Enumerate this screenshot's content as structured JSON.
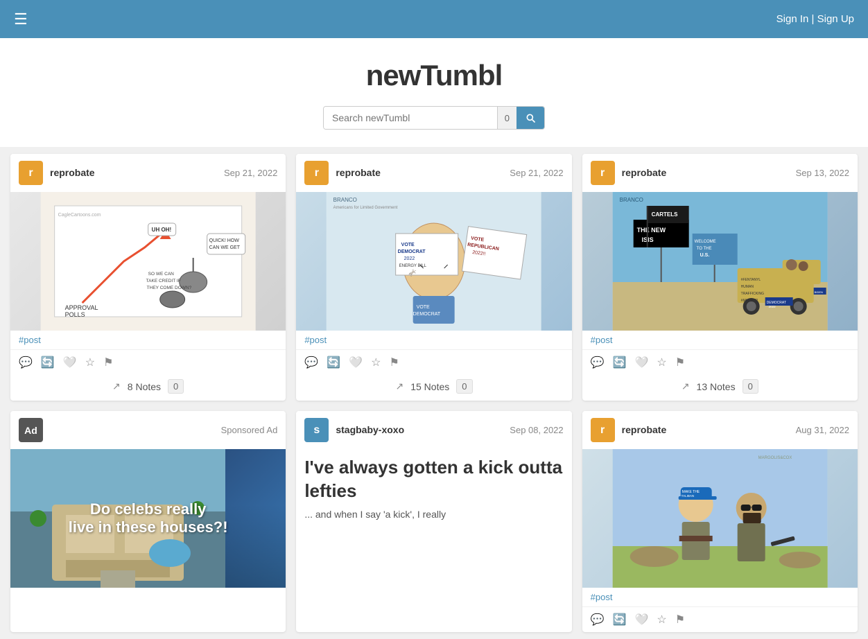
{
  "header": {
    "hamburger_label": "☰",
    "sign_in_label": "Sign In",
    "separator": "|",
    "sign_up_label": "Sign Up"
  },
  "site": {
    "title": "newTumbl"
  },
  "search": {
    "placeholder": "Search newTumbl",
    "count": "0",
    "button_label": "🔍"
  },
  "cards": [
    {
      "id": "card-1",
      "user": "reprobate",
      "avatar_letter": "r",
      "avatar_color": "orange",
      "date": "Sep 21, 2022",
      "image_alt": "Political cartoon - gas prices approval polls",
      "tag": "#post",
      "notes_count": "8 Notes",
      "notes_badge": "0",
      "type": "image"
    },
    {
      "id": "card-2",
      "user": "reprobate",
      "avatar_letter": "r",
      "avatar_color": "orange",
      "date": "Sep 21, 2022",
      "image_alt": "Political cartoon - vote democrat 2022 energy bill",
      "tag": "#post",
      "notes_count": "15 Notes",
      "notes_badge": "0",
      "type": "image"
    },
    {
      "id": "card-3",
      "user": "reprobate",
      "avatar_letter": "r",
      "avatar_color": "orange",
      "date": "Sep 13, 2022",
      "image_alt": "Political cartoon - The New ISIS Cartels",
      "tag": "#post",
      "notes_count": "13 Notes",
      "notes_badge": "0",
      "type": "image"
    },
    {
      "id": "card-ad",
      "user": "Ad",
      "sponsored": "Sponsored Ad",
      "image_text": "Do celebs really\nlive in these houses?!",
      "type": "ad"
    },
    {
      "id": "card-5",
      "user": "stagbaby-xoxo",
      "avatar_letter": "s",
      "avatar_color": "teal",
      "date": "Sep 08, 2022",
      "post_title": "I've always gotten a kick outta lefties",
      "post_excerpt": "... and when I say 'a kick', I really",
      "type": "post"
    },
    {
      "id": "card-6",
      "user": "reprobate",
      "avatar_letter": "r",
      "avatar_color": "orange",
      "date": "Aug 31, 2022",
      "image_alt": "Political cartoon - Make the Taliban Great Again",
      "tag": "#post",
      "notes_count": "",
      "notes_badge": "",
      "type": "image"
    }
  ],
  "icons": {
    "comment": "💬",
    "repost": "🔁",
    "like": "🤍",
    "star": "⭐",
    "flag": "🚩",
    "share": "↗"
  }
}
